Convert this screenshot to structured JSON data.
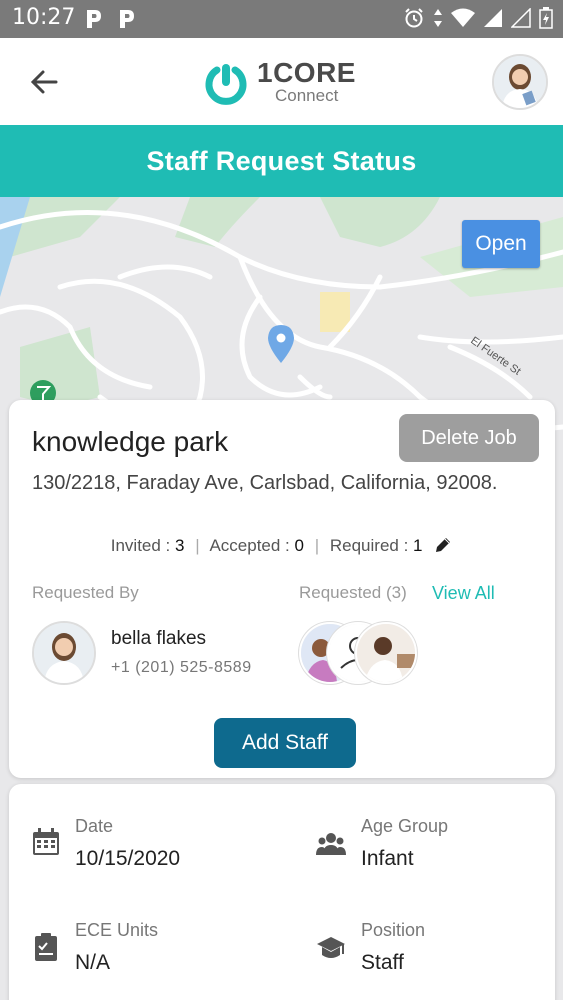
{
  "status_bar": {
    "time": "10:27",
    "left_icons": [
      "p-notification-icon",
      "p-notification-icon"
    ],
    "right_icons": [
      "alarm-icon",
      "data-arrows-icon",
      "wifi-icon",
      "signal-icon",
      "signal-icon",
      "battery-icon"
    ]
  },
  "header": {
    "back_icon": "arrow-left-icon",
    "logo_brand": "1CORE",
    "logo_sub": "Connect",
    "avatar": "profile-avatar"
  },
  "title_bar": {
    "title": "Staff Request Status"
  },
  "map": {
    "open_label": "Open",
    "street_label": "El Fuerte St",
    "pin_color": "#6fa8e6"
  },
  "job": {
    "name": "knowledge park",
    "delete_label": "Delete Job",
    "address": "130/2218, Faraday Ave, Carlsbad, California, 92008.",
    "invited_label": "Invited :",
    "invited": "3",
    "accepted_label": "Accepted :",
    "accepted": "0",
    "required_label": "Required :",
    "required": "1",
    "requested_by_label": "Requested By",
    "requested_label": "Requested (3)",
    "view_all_label": "View All",
    "requester_name": "bella flakes",
    "requester_phone": "+1 (201) 525-8589",
    "add_staff_label": "Add Staff"
  },
  "details": {
    "date_label": "Date",
    "date_value": "10/15/2020",
    "age_group_label": "Age Group",
    "age_group_value": "Infant",
    "ece_units_label": "ECE Units",
    "ece_units_value": "N/A",
    "position_label": "Position",
    "position_value": "Staff"
  },
  "colors": {
    "accent": "#1fbcb4",
    "primary_button": "#0e6a8e",
    "open_button": "#4a90e2",
    "delete_button": "#9e9e9e"
  }
}
